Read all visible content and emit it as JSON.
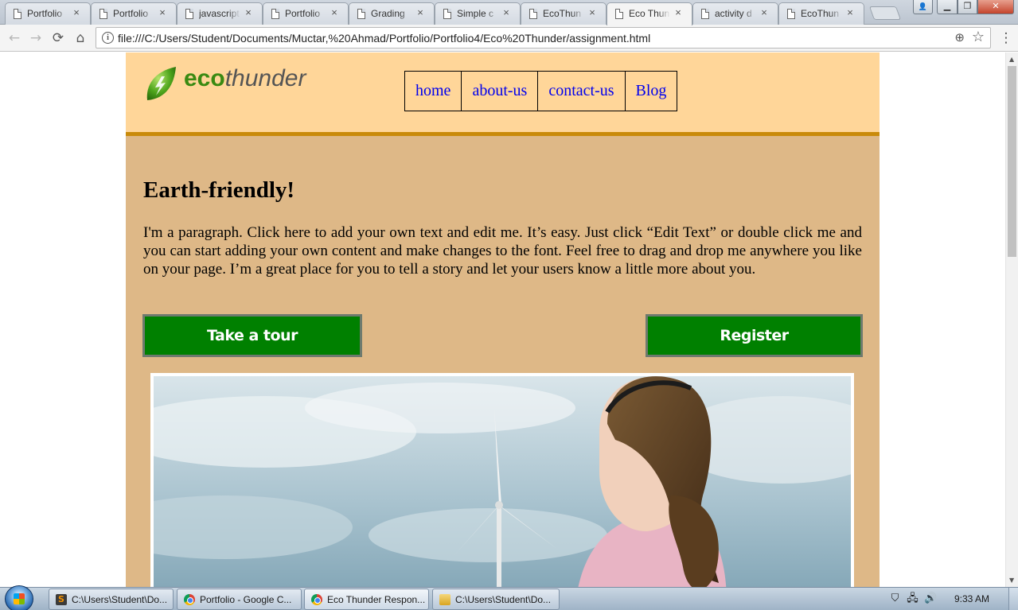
{
  "browser": {
    "tabs": [
      {
        "title": "Portfolio",
        "close": "×"
      },
      {
        "title": "Portfolio",
        "close": "×"
      },
      {
        "title": "javascript",
        "close": "×"
      },
      {
        "title": "Portfolio",
        "close": "×"
      },
      {
        "title": "Grading",
        "close": "×"
      },
      {
        "title": "Simple c",
        "close": "×"
      },
      {
        "title": "EcoThun",
        "close": "×"
      },
      {
        "title": "Eco Thun",
        "close": "×"
      },
      {
        "title": "activity d",
        "close": "×"
      },
      {
        "title": "EcoThun",
        "close": "×"
      }
    ],
    "active_tab_index": 7,
    "url": "file:///C:/Users/Student/Documents/Muctar,%20Ahmad/Portfolio/Portfolio4/Eco%20Thunder/assignment.html",
    "window_controls": {
      "minimize": "▁",
      "maximize": "❐",
      "close": "✕",
      "user": "👤"
    },
    "icons": {
      "back": "←",
      "forward": "→",
      "reload": "⟳",
      "home": "⌂",
      "info": "i",
      "zoom": "⊕",
      "star": "☆",
      "menu": "⋮"
    }
  },
  "site": {
    "logo": {
      "eco": "eco",
      "thunder": "thunder"
    },
    "nav": [
      {
        "label": "home"
      },
      {
        "label": "about-us"
      },
      {
        "label": "contact-us"
      },
      {
        "label": "Blog"
      }
    ],
    "headline": "Earth-friendly!",
    "paragraph": "I'm a paragraph. Click here to add your own text and edit me. It’s easy. Just click “Edit Text” or double click me and you can start adding your own content and make changes to the font. Feel free to drag and drop me anywhere you like on your page. I’m a great place for you to tell a story and let your users know a little more about you.",
    "buttons": {
      "tour": "Take a tour",
      "register": "Register"
    },
    "colors": {
      "header_bg": "#ffd699",
      "body_bg": "#deb887",
      "header_border": "#c98a0a",
      "button_bg": "#008000",
      "nav_link": "#0000ee"
    }
  },
  "taskbar": {
    "items": [
      {
        "label": "C:\\Users\\Student\\Do...",
        "icon": "sublime-icon"
      },
      {
        "label": "Portfolio - Google C...",
        "icon": "chrome-icon"
      },
      {
        "label": "Eco Thunder Respon...",
        "icon": "chrome-icon"
      },
      {
        "label": "C:\\Users\\Student\\Do...",
        "icon": "folder-icon"
      }
    ],
    "tray": {
      "shield": "⛉",
      "network": "🖧",
      "volume": "🔊"
    },
    "clock": "9:33 AM"
  }
}
